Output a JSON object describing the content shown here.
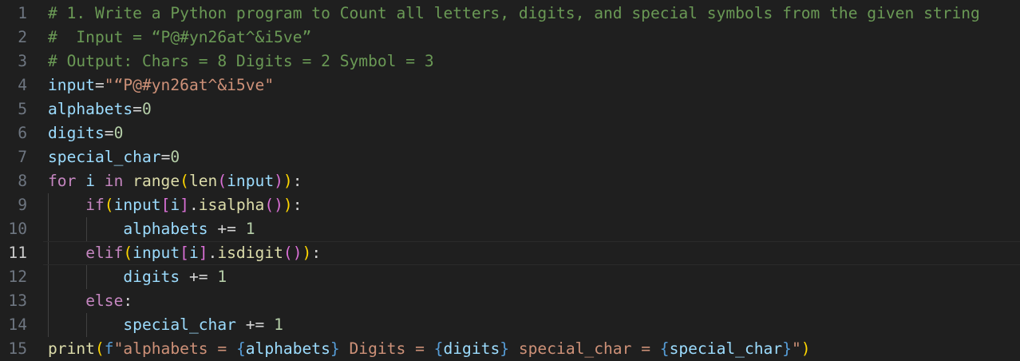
{
  "editor": {
    "lines": [
      {
        "num": "1",
        "tokens": [
          [
            "# 1. Write a Python program to Count all letters, digits, and special symbols from the given string",
            "comment"
          ]
        ]
      },
      {
        "num": "2",
        "tokens": [
          [
            "#  Input = “P@#yn26at^&i5ve”",
            "comment"
          ]
        ]
      },
      {
        "num": "3",
        "tokens": [
          [
            "# Output: Chars = 8 Digits = 2 Symbol = 3",
            "comment"
          ]
        ]
      },
      {
        "num": "4",
        "tokens": [
          [
            "input",
            "var"
          ],
          [
            "=",
            "op"
          ],
          [
            "\"“P@#yn26at^&i5ve\"",
            "str"
          ]
        ]
      },
      {
        "num": "5",
        "tokens": [
          [
            "alphabets",
            "var"
          ],
          [
            "=",
            "op"
          ],
          [
            "0",
            "num"
          ]
        ]
      },
      {
        "num": "6",
        "tokens": [
          [
            "digits",
            "var"
          ],
          [
            "=",
            "op"
          ],
          [
            "0",
            "num"
          ]
        ]
      },
      {
        "num": "7",
        "tokens": [
          [
            "special_char",
            "var"
          ],
          [
            "=",
            "op"
          ],
          [
            "0",
            "num"
          ]
        ]
      },
      {
        "num": "8",
        "tokens": [
          [
            "for",
            "kw"
          ],
          [
            " ",
            "op"
          ],
          [
            "i",
            "var"
          ],
          [
            " ",
            "op"
          ],
          [
            "in",
            "kw"
          ],
          [
            " ",
            "op"
          ],
          [
            "range",
            "fn"
          ],
          [
            "(",
            "br1"
          ],
          [
            "len",
            "fn"
          ],
          [
            "(",
            "br2"
          ],
          [
            "input",
            "var"
          ],
          [
            ")",
            "br2"
          ],
          [
            ")",
            "br1"
          ],
          [
            ":",
            "op"
          ]
        ]
      },
      {
        "num": "9",
        "indent": 1,
        "tokens": [
          [
            "    ",
            "op"
          ],
          [
            "if",
            "kw"
          ],
          [
            "(",
            "br1"
          ],
          [
            "input",
            "var"
          ],
          [
            "[",
            "br2"
          ],
          [
            "i",
            "var"
          ],
          [
            "]",
            "br2"
          ],
          [
            ".",
            "op"
          ],
          [
            "isalpha",
            "fn"
          ],
          [
            "(",
            "br2"
          ],
          [
            ")",
            "br2"
          ],
          [
            ")",
            "br1"
          ],
          [
            ":",
            "op"
          ]
        ]
      },
      {
        "num": "10",
        "indent": 2,
        "tokens": [
          [
            "        ",
            "op"
          ],
          [
            "alphabets",
            "var"
          ],
          [
            " += ",
            "op"
          ],
          [
            "1",
            "num"
          ]
        ]
      },
      {
        "num": "11",
        "indent": 1,
        "active": true,
        "tokens": [
          [
            "    ",
            "op"
          ],
          [
            "elif",
            "kw"
          ],
          [
            "(",
            "br1"
          ],
          [
            "input",
            "var"
          ],
          [
            "[",
            "br2"
          ],
          [
            "i",
            "var"
          ],
          [
            "]",
            "br2"
          ],
          [
            ".",
            "op"
          ],
          [
            "isdigit",
            "fn"
          ],
          [
            "(",
            "br2"
          ],
          [
            ")",
            "br2"
          ],
          [
            ")",
            "br1"
          ],
          [
            ":",
            "op"
          ]
        ]
      },
      {
        "num": "12",
        "indent": 2,
        "tokens": [
          [
            "        ",
            "op"
          ],
          [
            "digits",
            "var"
          ],
          [
            " += ",
            "op"
          ],
          [
            "1",
            "num"
          ]
        ]
      },
      {
        "num": "13",
        "indent": 1,
        "tokens": [
          [
            "    ",
            "op"
          ],
          [
            "else",
            "kw"
          ],
          [
            ":",
            "op"
          ]
        ]
      },
      {
        "num": "14",
        "indent": 2,
        "tokens": [
          [
            "        ",
            "op"
          ],
          [
            "special_char",
            "var"
          ],
          [
            " += ",
            "op"
          ],
          [
            "1",
            "num"
          ]
        ]
      },
      {
        "num": "15",
        "tokens": [
          [
            "print",
            "fn"
          ],
          [
            "(",
            "br1"
          ],
          [
            "f",
            "fstr"
          ],
          [
            "\"alphabets = ",
            "str"
          ],
          [
            "{",
            "fstr"
          ],
          [
            "alphabets",
            "var"
          ],
          [
            "}",
            "fstr"
          ],
          [
            " Digits = ",
            "str"
          ],
          [
            "{",
            "fstr"
          ],
          [
            "digits",
            "var"
          ],
          [
            "}",
            "fstr"
          ],
          [
            " special_char = ",
            "str"
          ],
          [
            "{",
            "fstr"
          ],
          [
            "special_char",
            "var"
          ],
          [
            "}",
            "fstr"
          ],
          [
            "\"",
            "str"
          ],
          [
            ")",
            "br1"
          ]
        ]
      }
    ]
  },
  "colors": {
    "background": "#1f1f1f",
    "comment": "#6a9955",
    "variable": "#9cdcfe",
    "string": "#ce9178",
    "number": "#b5cea8",
    "keyword": "#c586c0",
    "function": "#dcdcaa",
    "bracket_level_1": "#ffd700",
    "bracket_level_2": "#da70d6"
  }
}
